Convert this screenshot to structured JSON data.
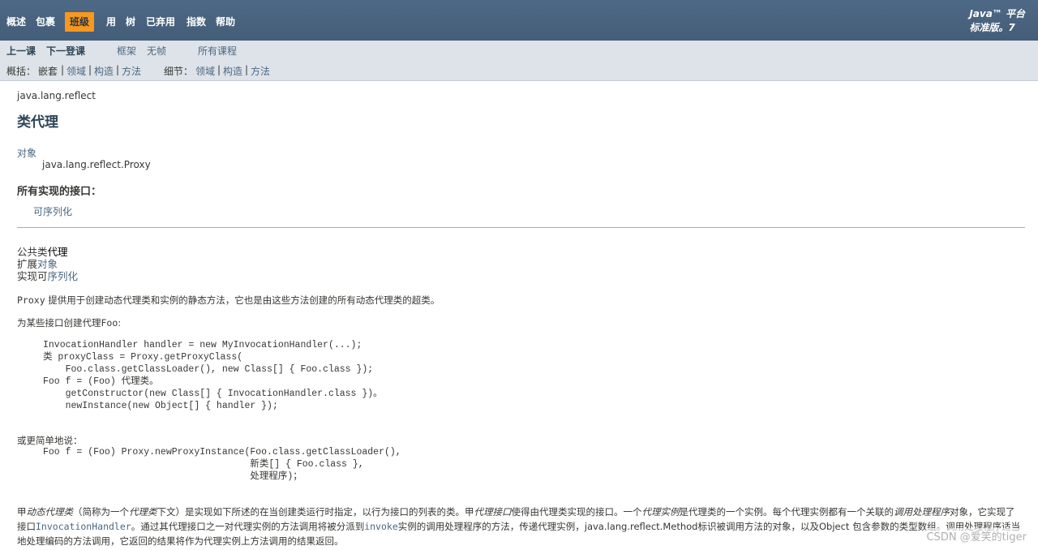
{
  "topnav": {
    "items": [
      "概述",
      "包裹",
      "班级",
      "用",
      "树",
      "已弃用",
      "指数",
      "帮助"
    ],
    "active_index": 2,
    "about_line1": "Java™ 平台",
    "about_line2": "标准版。7"
  },
  "subnav": {
    "prev_class": "上一课",
    "next_class": "下一登课",
    "frames": "框架",
    "no_frames": "无帧",
    "all_classes": "所有课程",
    "summary_label": "概括：",
    "summary_nested": "嵌套",
    "summary_field": "领域",
    "summary_constr": "构造",
    "summary_method": "方法",
    "detail_label": "细节：",
    "detail_field": "领域",
    "detail_constr": "构造",
    "detail_method": "方法",
    "sep": "|"
  },
  "header": {
    "package": "java.lang.reflect",
    "title": "类代理"
  },
  "inheritance": {
    "object": "对象",
    "subclass": "java.lang.reflect.Proxy"
  },
  "interfaces": {
    "heading": "所有实现的接口：",
    "item": "可序列化"
  },
  "declaration": {
    "line1_prefix": "公共类",
    "line1_name": "代理",
    "line2_prefix": "扩展",
    "line2_link": "对象",
    "line3_prefix": "实现可",
    "line3_link": "序列化"
  },
  "intro": {
    "proxy_word": "Proxy",
    "text": " 提供用于创建动态代理类和实例的静态方法，它也是由这些方法创建的所有动态代理类的超类。",
    "foo_prefix": "为某些接口创建代理",
    "foo_word": "Foo",
    "foo_suffix": ":"
  },
  "code1": "InvocationHandler handler = new MyInvocationHandler(...);\n类 proxyClass = Proxy.getProxyClass(\n    Foo.class.getClassLoader(), new Class[] { Foo.class });\nFoo f = (Foo) 代理类。\n    getConstructor(new Class[] { InvocationHandler.class })。\n    newInstance(new Object[] { handler });",
  "simpler": "或更简单地说：",
  "code2": "Foo f = (Foo) Proxy.newProxyInstance(Foo.class.getClassLoader(),\n                                     新类[] { Foo.class },\n                                     处理程序)；",
  "description": {
    "p1": "甲",
    "e1": "动态代理类",
    "p2": "（简称为一个",
    "e2": "代理类",
    "p3": "下文）是实现如下所述的在当创建类运行时指定，以行为接口的列表的类。甲",
    "e3": "代理接口",
    "p4": "使得由代理类实现的接口。一个",
    "e4": "代理实例",
    "p5": "是代理类的一个实例。每个代理实例都有一个关联的",
    "e5": "调用处理程序",
    "p6": "对象，它实现了接口",
    "l1": "InvocationHandler",
    "p7": "。通过其代理接口之一对代理实例的方法调用将被分派到",
    "l2": "invoke",
    "p8": "实例的调用处理程序的方法，传递代理实例，java.lang.reflect.Method标识被调用方法的对象，以及Object 包含参数的类型数组。调用处理程序适当地处理编码的方法调用，它返回的结果将作为代理实例上方法调用的结果返回。"
  },
  "watermark": "CSDN @爱笑的tiger",
  "colors": {
    "nav_bg": "#4d6784",
    "nav_active": "#f8981d",
    "subnav_bg": "#dee3e9",
    "link": "#4a6782",
    "title": "#2c4557"
  }
}
